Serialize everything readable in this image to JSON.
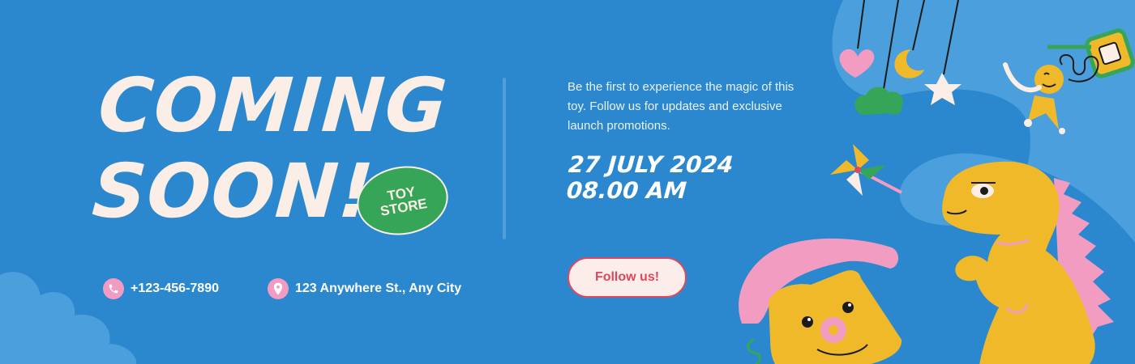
{
  "headline": {
    "line1": "COMING",
    "line2": "SOON!"
  },
  "badge": {
    "line1": "TOY",
    "line2": "STORE"
  },
  "contact": {
    "phone": "+123-456-7890",
    "address": "123 Anywhere St., Any City",
    "phone_icon": "phone-icon",
    "address_icon": "location-pin-icon"
  },
  "tagline": "Be the first to experience the magic of this toy. Follow us for updates and exclusive launch promotions.",
  "event": {
    "date": "27 JULY 2024",
    "time": "08.00 AM"
  },
  "cta": {
    "label": "Follow us!"
  },
  "colors": {
    "background": "#2b88cf",
    "headline": "#faeee6",
    "badge": "#37a558",
    "accent_pink": "#f39cc2",
    "cta_text": "#e0475e",
    "dino": "#f0b92a"
  }
}
